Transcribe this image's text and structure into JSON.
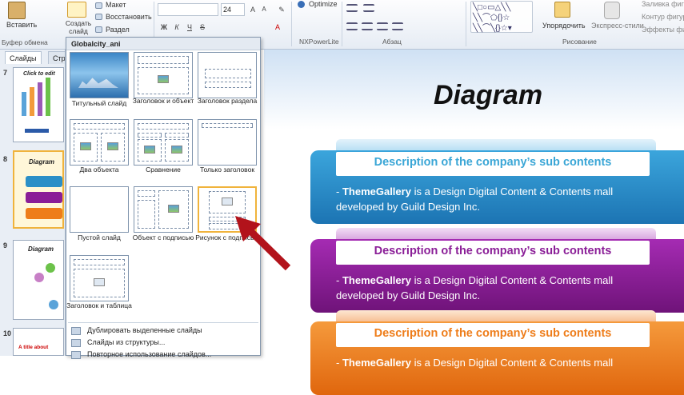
{
  "ribbon": {
    "paste_label": "Вставить",
    "new_slide_label": "Создать слайд",
    "layout_label": "Макет",
    "reset_label": "Восстановить",
    "section_label": "Раздел",
    "font_size": "24",
    "optimize_label": "Optimize",
    "nxpowerlite_label": "NXPowerLite",
    "paragraph_label": "Абзац",
    "arrange_label": "Упорядочить",
    "quick_styles_label": "Экспресс-стили",
    "shape_fill_label": "Заливка фигуры",
    "shape_outline_label": "Контур фигуры",
    "shape_effects_label": "Эффекты фигур",
    "drawing_label": "Рисование",
    "clipboard_label": "Буфер обмена",
    "bold": "Ж",
    "italic": "К",
    "underline": "Ч",
    "strike": "S"
  },
  "tabs": {
    "slides": "Слайды",
    "outline": "Структура"
  },
  "thumbs": [
    {
      "num": "7",
      "title": "Click to edit"
    },
    {
      "num": "8",
      "title": "Diagram"
    },
    {
      "num": "9",
      "title": "Diagram"
    },
    {
      "num": "10",
      "title": "A title about"
    }
  ],
  "gallery": {
    "header": "Globalcity_ani",
    "layouts": [
      {
        "label": "Титульный слайд"
      },
      {
        "label": "Заголовок и объект"
      },
      {
        "label": "Заголовок раздела"
      },
      {
        "label": "Два объекта"
      },
      {
        "label": "Сравнение"
      },
      {
        "label": "Только заголовок"
      },
      {
        "label": "Пустой слайд"
      },
      {
        "label": "Объект с подписью"
      },
      {
        "label": "Рисунок с подписью"
      },
      {
        "label": "Заголовок и таблица"
      }
    ],
    "menu": [
      "Дублировать выделенные слайды",
      "Слайды из структуры...",
      "Повторное использование слайдов..."
    ]
  },
  "slide": {
    "title": "Diagram",
    "blocks": [
      {
        "heading": "Description of the company’s sub contents",
        "brand": "ThemeGallery",
        "line1": " is a Design Digital Content & Contents mall",
        "line2": "developed by Guild Design Inc.",
        "color": "#2b8fc7",
        "heading_color": "#3aa6d6"
      },
      {
        "heading": "Description of the company’s sub contents",
        "brand": "ThemeGallery",
        "line1": " is a Design Digital Content & Contents mall",
        "line2": "developed by Guild Design Inc.",
        "color": "#8a1e97",
        "heading_color": "#8a1e97"
      },
      {
        "heading": "Description of the company’s sub contents",
        "brand": "ThemeGallery",
        "line1": " is a Design Digital Content & Contents mall",
        "line2": "",
        "color": "#ee7d1a",
        "heading_color": "#ee7d1a"
      }
    ]
  }
}
